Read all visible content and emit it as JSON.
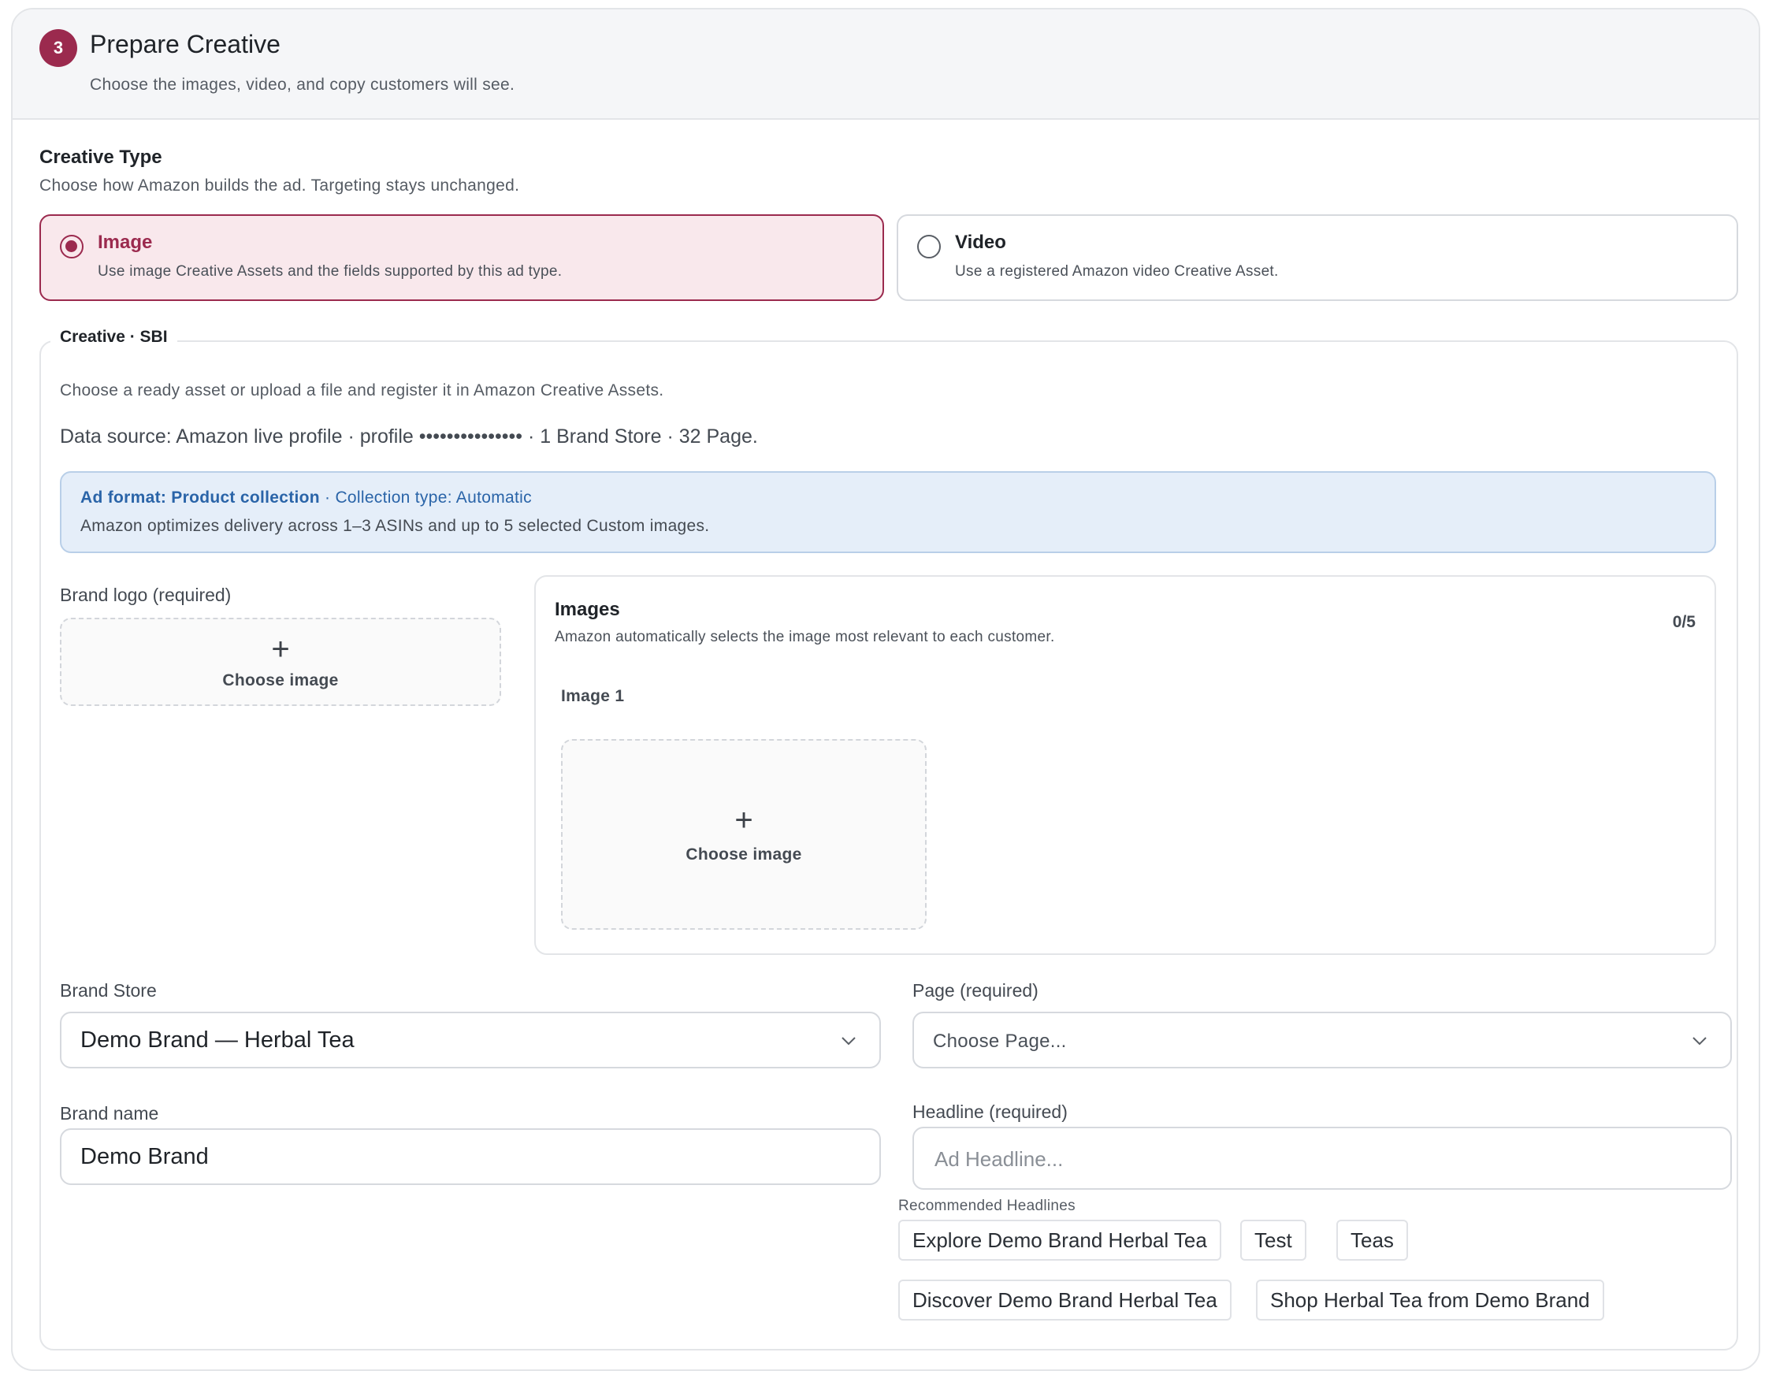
{
  "header": {
    "step_number": "3",
    "title": "Prepare Creative",
    "subtitle": "Choose the images, video, and copy customers will see."
  },
  "creative_type": {
    "title": "Creative Type",
    "subtitle": "Choose how Amazon builds the ad. Targeting stays unchanged.",
    "options": [
      {
        "title": "Image",
        "description": "Use image Creative Assets and the fields supported by this ad type.",
        "selected": true
      },
      {
        "title": "Video",
        "description": "Use a registered Amazon video Creative Asset.",
        "selected": false
      }
    ]
  },
  "creative_section": {
    "legend": "Creative · SBI",
    "description": "Choose a ready asset or upload a file and register it in Amazon Creative Assets.",
    "data_source": "Data source: Amazon live profile · profile ••••••••••••••• · 1 Brand Store · 32 Page.",
    "info": {
      "ad_format": "Ad format: Product collection",
      "collection_type": " · Collection type: Automatic",
      "note": "Amazon optimizes delivery across 1–3 ASINs and up to 5 selected Custom images."
    },
    "brand_logo": {
      "label": "Brand logo (required)",
      "button": "Choose image"
    },
    "images": {
      "title": "Images",
      "subtitle": "Amazon automatically selects the image most relevant to each customer.",
      "count": "0/5",
      "image1_label": "Image 1",
      "button": "Choose image"
    },
    "brand_store": {
      "label": "Brand Store",
      "value": "Demo Brand — Herbal Tea"
    },
    "page": {
      "label": "Page (required)",
      "placeholder": "Choose Page..."
    },
    "brand_name": {
      "label": "Brand name",
      "value": "Demo Brand"
    },
    "headline": {
      "label": "Headline (required)",
      "placeholder": "Ad Headline..."
    },
    "recommended": {
      "label": "Recommended Headlines",
      "chips": [
        "Explore Demo Brand Herbal Tea",
        "Test",
        "Teas",
        "Discover Demo Brand Herbal Tea",
        "Shop Herbal Tea from Demo Brand"
      ]
    }
  },
  "colors": {
    "accent": "#9b2a4e",
    "selected_bg": "#f9e8ec",
    "info_bg": "#e5eef9",
    "info_text": "#2a64a8"
  },
  "icons": [
    "plus-icon",
    "chevron-down-icon",
    "radio-checked-icon",
    "radio-unchecked-icon"
  ]
}
